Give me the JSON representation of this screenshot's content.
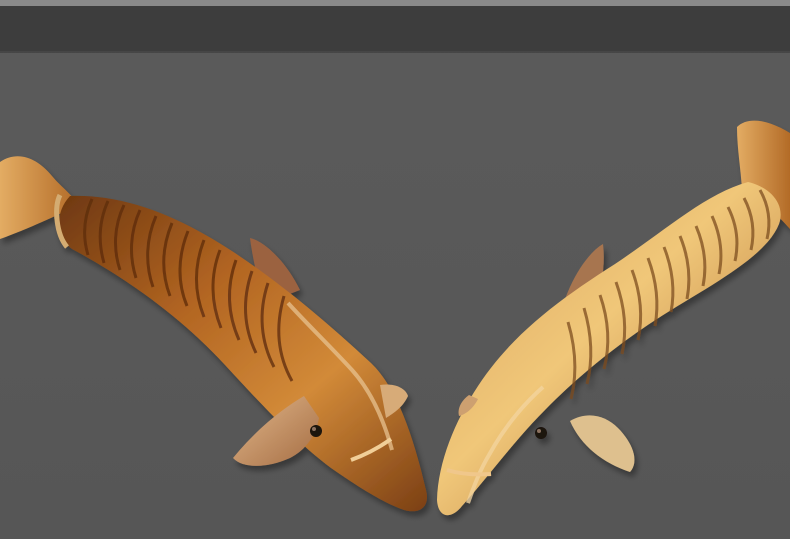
{
  "scene": {
    "subject": "wooden-dolphin-toys",
    "count": 2
  },
  "colors": {
    "background": "#5a5a5a",
    "top_bar": "#3d3d3d",
    "wood_dark": "#8b4a18",
    "wood_mid": "#c57a2c",
    "wood_light": "#e7b46a",
    "wood_pale": "#f0d8a8"
  }
}
